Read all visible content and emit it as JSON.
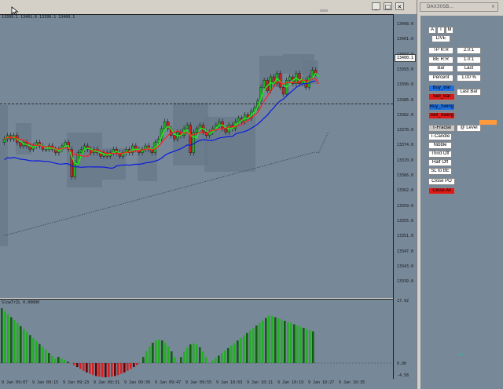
{
  "chart": {
    "ohlc_text": "13399.1 13401.6 13399.1 13400.1",
    "current_price": "13400.1",
    "oscillator_title": "SlowTrZL 0.00000",
    "y_labels": [
      "13408.0",
      "13401.0",
      "13397.0",
      "13393.0",
      "13390.0",
      "13386.0",
      "13382.0",
      "13378.0",
      "13374.0",
      "13370.0",
      "13366.0",
      "13362.0",
      "13359.0",
      "13355.0",
      "13351.0",
      "13347.0",
      "13343.0",
      "13339.0"
    ],
    "osc_y_labels": [
      "17.92",
      "0.00",
      "-4.58"
    ],
    "x_labels": [
      "9 Jan 09:07",
      "9 Jan 09:15",
      "9 Jan 09:23",
      "9 Jan 09:31",
      "9 Jan 09:39",
      "9 Jan 09:47",
      "9 Jan 09:55",
      "9 Jan 10:03",
      "9 Jan 10:11",
      "9 Jan 10:19",
      "9 Jan 10:27",
      "9 Jan 10:35"
    ],
    "colors": {
      "bull": "#22b022",
      "bear": "#d42020",
      "fast": "#22ee22",
      "mid": "#ff2020",
      "slow": "#0a1ae0",
      "bg": "#778899"
    }
  },
  "panel": {
    "title": "DAX30SB...",
    "buttons": {
      "a": "A",
      "t": "T",
      "m": "M",
      "live": "LIVE",
      "tp_rr": "TP R:R",
      "tp_rr_val": "2.0:1",
      "be_rr": "BE R:R",
      "be_rr_val": "1.0:1",
      "bar": "Bar",
      "last": "Last",
      "percent": "Percent",
      "percent_val": "1.00 %",
      "buy_bar": "Buy_Bar",
      "sell_bar": "Sell_Bar",
      "last_bar": "Last Bar",
      "buy_swing": "Buy_Swing",
      "sell_swing": "Sell_Swing",
      "t_fractal": "T-Fractal",
      "at_level": "@ Level",
      "t_candle": "T-Candle",
      "nibble": "Nibble",
      "third_off": "Third Off",
      "half_off": "Half Off",
      "sl_to_be": "SL to BE",
      "close_po": "Close PO",
      "close_all": "Close All"
    }
  }
}
